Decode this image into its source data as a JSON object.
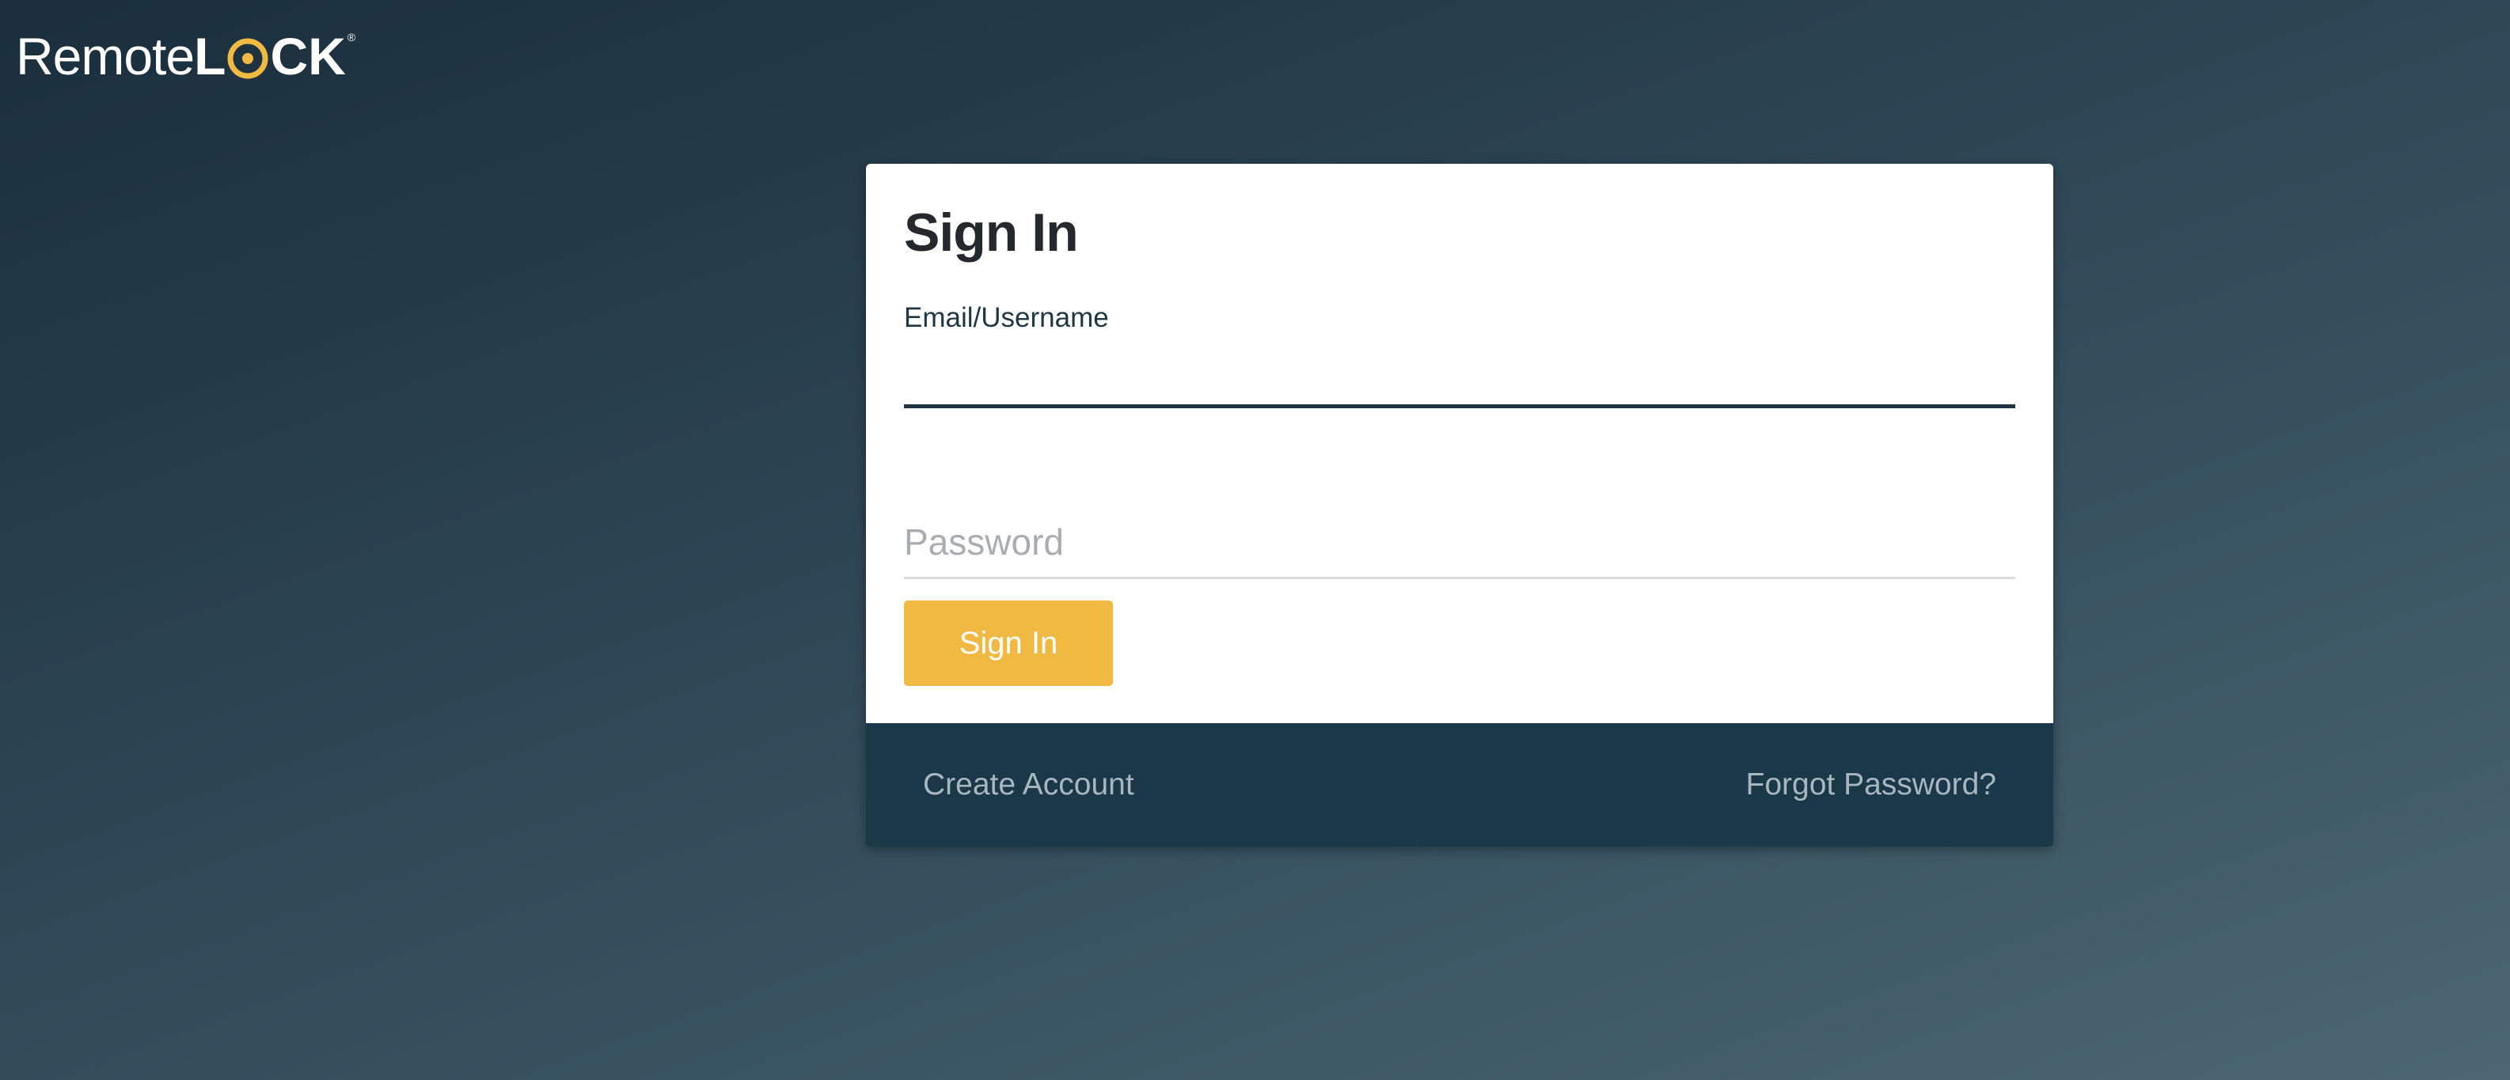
{
  "logo": {
    "remote": "Remote",
    "lock_l": "L",
    "lock_ck": "CK",
    "trademark": "®"
  },
  "signin": {
    "title": "Sign In",
    "email_label": "Email/Username",
    "email_value": "",
    "password_placeholder": "Password",
    "password_value": "",
    "button_label": "Sign In"
  },
  "footer": {
    "create_account": "Create Account",
    "forgot_password": "Forgot Password?"
  },
  "colors": {
    "accent": "#f0b941",
    "footer_bg": "#1b3849",
    "input_active": "#1e3341"
  },
  "icons": {
    "logo_o": "lock-wifi-icon"
  }
}
